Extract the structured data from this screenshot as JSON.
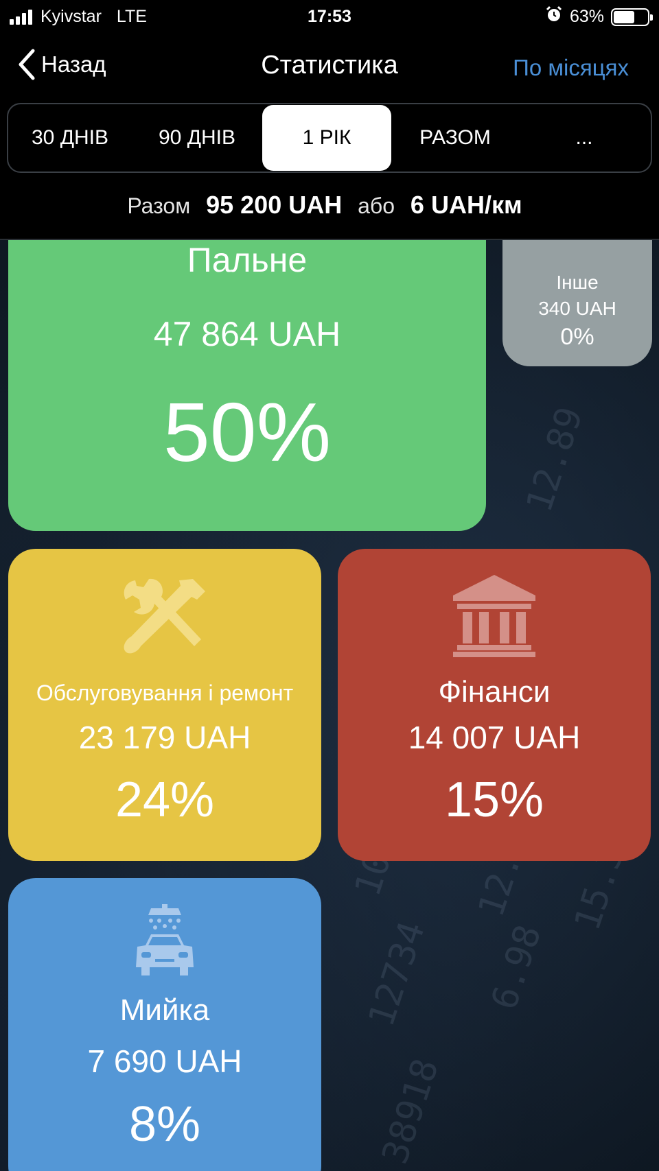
{
  "status_bar": {
    "carrier": "Kyivstar",
    "network": "LTE",
    "time": "17:53",
    "battery": "63%",
    "battery_level": 0.63,
    "alarm_icon": "alarm-icon"
  },
  "nav": {
    "back_label": "Назад",
    "title": "Статистика",
    "right_label": "По місяцях"
  },
  "segments": [
    {
      "label": "30 ДНІВ",
      "active": false
    },
    {
      "label": "90 ДНІВ",
      "active": false
    },
    {
      "label": "1 РІК",
      "active": true
    },
    {
      "label": "РАЗОМ",
      "active": false
    },
    {
      "label": "...",
      "active": false
    }
  ],
  "summary": {
    "total_label": "Разом",
    "total_value": "95 200 UAH",
    "or_label": "або",
    "per_km": "6 UAH/км"
  },
  "categories": {
    "fuel": {
      "name": "Пальне",
      "amount": "47 864 UAH",
      "percent": "50%",
      "color": "#65c978"
    },
    "other": {
      "name": "Інше",
      "amount": "340 UAH",
      "percent": "0%",
      "color": "#96a0a2",
      "icon": "more-dots-icon"
    },
    "service": {
      "name": "Обслуговування і ремонт",
      "amount": "23 179 UAH",
      "percent": "24%",
      "color": "#e6c544",
      "icon": "wrench-screwdriver-icon"
    },
    "finance": {
      "name": "Фінанси",
      "amount": "14 007 UAH",
      "percent": "15%",
      "color": "#b14435",
      "icon": "bank-icon"
    },
    "wash": {
      "name": "Мийка",
      "amount": "7 690 UAH",
      "percent": "8%",
      "color": "#5497d6",
      "icon": "car-wash-icon"
    }
  },
  "background_numbers": [
    "10580",
    "12734",
    "38918",
    "12.59",
    "6.98",
    "15.32",
    "12.89"
  ]
}
